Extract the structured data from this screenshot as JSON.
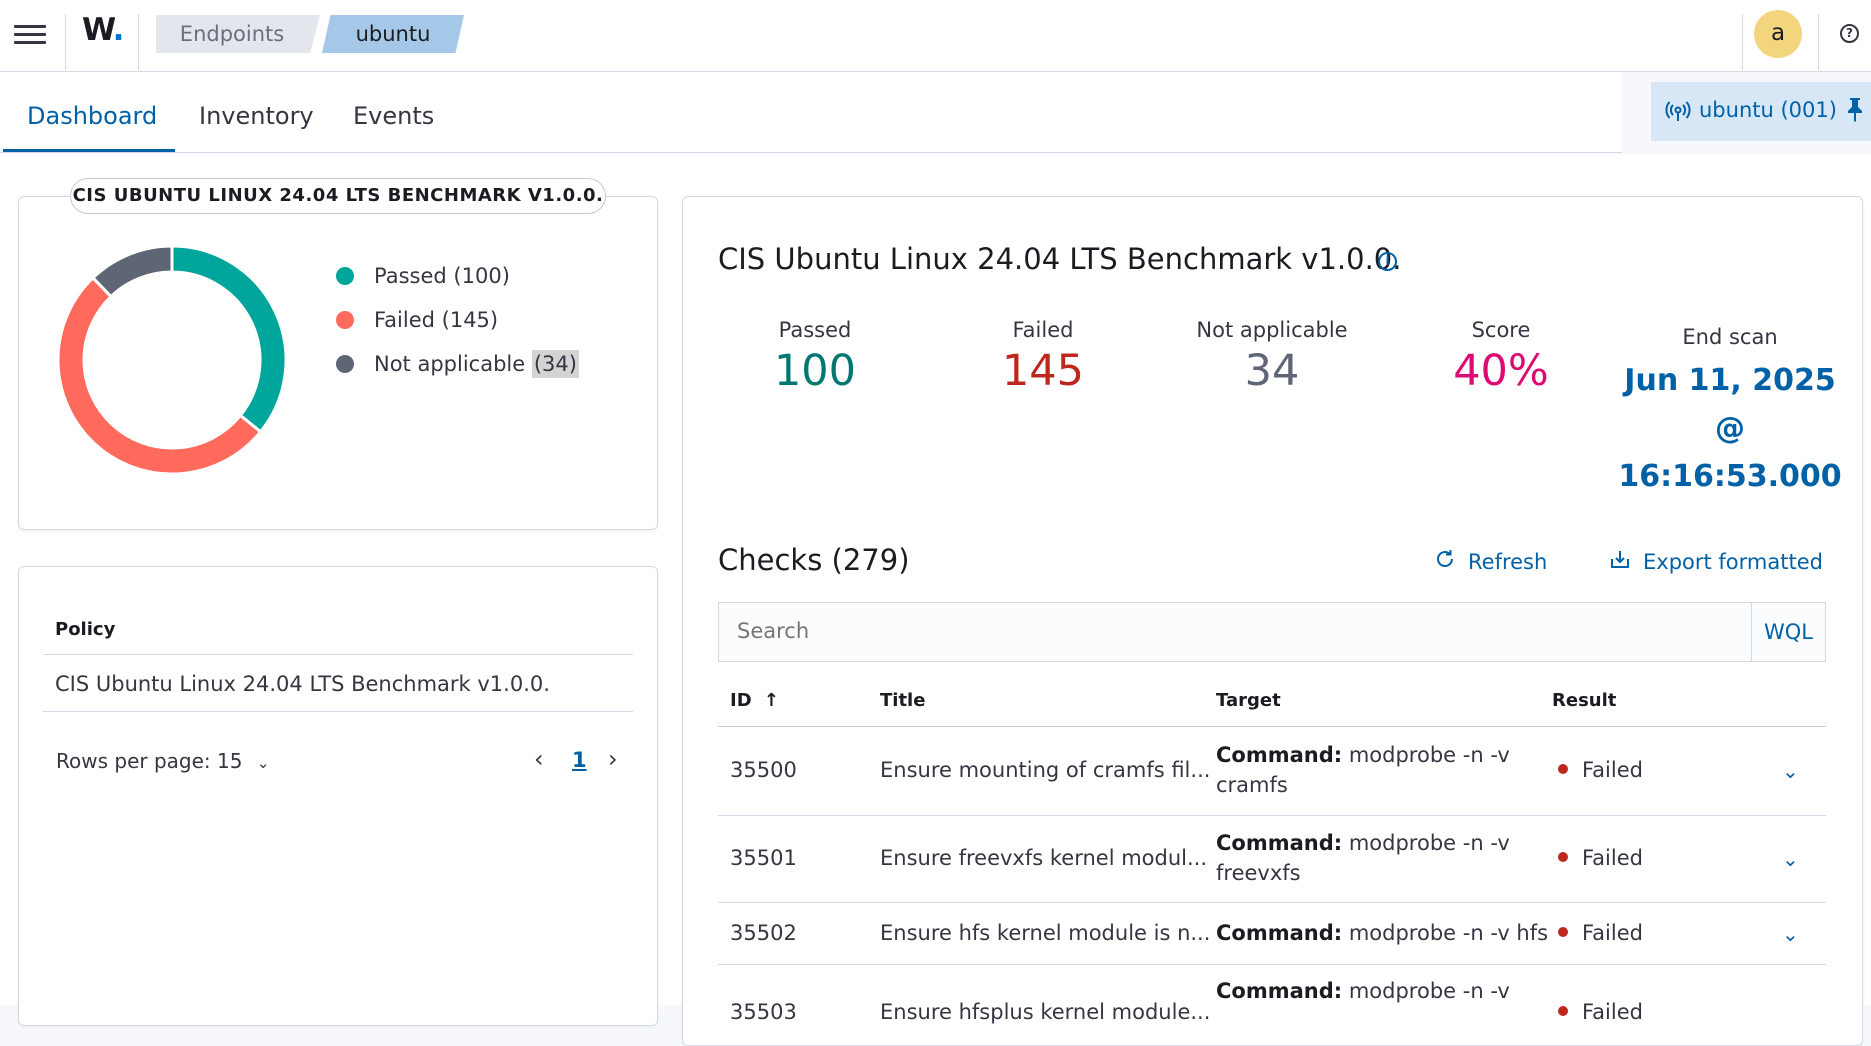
{
  "header": {
    "logo": "W",
    "logo_dot": ".",
    "breadcrumbs": [
      "Endpoints",
      "ubuntu"
    ],
    "avatar_initial": "a",
    "help_glyph": "?"
  },
  "tabs": [
    {
      "label": "Dashboard",
      "active": true
    },
    {
      "label": "Inventory",
      "active": false
    },
    {
      "label": "Events",
      "active": false
    }
  ],
  "agent_pill": {
    "label": "ubuntu (001)"
  },
  "donut_card": {
    "title": "CIS UBUNTU LINUX 24.04 LTS BENCHMARK V1.0.0.",
    "legend": [
      {
        "label": "Passed",
        "count": "(100)",
        "color": "#00a69b"
      },
      {
        "label": "Failed",
        "count": "(145)",
        "color": "#ff6a5c"
      },
      {
        "label": "Not applicable",
        "count": "(34)",
        "color": "#5e6675"
      }
    ]
  },
  "policy_table": {
    "header": "Policy",
    "rows": [
      "CIS Ubuntu Linux 24.04 LTS Benchmark v1.0.0."
    ],
    "rows_per_page": "Rows per page: 15",
    "page": "1"
  },
  "summary": {
    "title": "CIS Ubuntu Linux 24.04 LTS Benchmark v1.0.0.",
    "stats": [
      {
        "label": "Passed",
        "value": "100",
        "color": "#007871"
      },
      {
        "label": "Failed",
        "value": "145",
        "color": "#bd271e"
      },
      {
        "label": "Not applicable",
        "value": "34",
        "color": "#5e6675"
      },
      {
        "label": "Score",
        "value": "40%",
        "color": "#dd0a73"
      }
    ],
    "end_scan": {
      "label": "End scan",
      "date": "Jun 11, 2025",
      "at": "@",
      "time": "16:16:53.000"
    }
  },
  "checks": {
    "title": "Checks (279)",
    "refresh_label": "Refresh",
    "export_label": "Export formatted",
    "search_placeholder": "Search",
    "wql_label": "WQL",
    "columns": [
      "ID",
      "Title",
      "Target",
      "Result"
    ],
    "rows": [
      {
        "id": "35500",
        "title": "Ensure mounting of cramfs fil...",
        "cmd_label": "Command:",
        "cmd": "modprobe -n -v",
        "cmd2": "cramfs",
        "result": "Failed"
      },
      {
        "id": "35501",
        "title": "Ensure freevxfs kernel modul...",
        "cmd_label": "Command:",
        "cmd": "modprobe -n -v",
        "cmd2": "freevxfs",
        "result": "Failed"
      },
      {
        "id": "35502",
        "title": "Ensure hfs kernel module is n...",
        "cmd_label": "Command:",
        "cmd": "modprobe -n -v hfs",
        "cmd2": "",
        "result": "Failed"
      },
      {
        "id": "35503",
        "title": "Ensure hfsplus kernel module...",
        "cmd_label": "Command:",
        "cmd": "modprobe -n -v",
        "cmd2": "",
        "result": "Failed"
      }
    ]
  }
}
